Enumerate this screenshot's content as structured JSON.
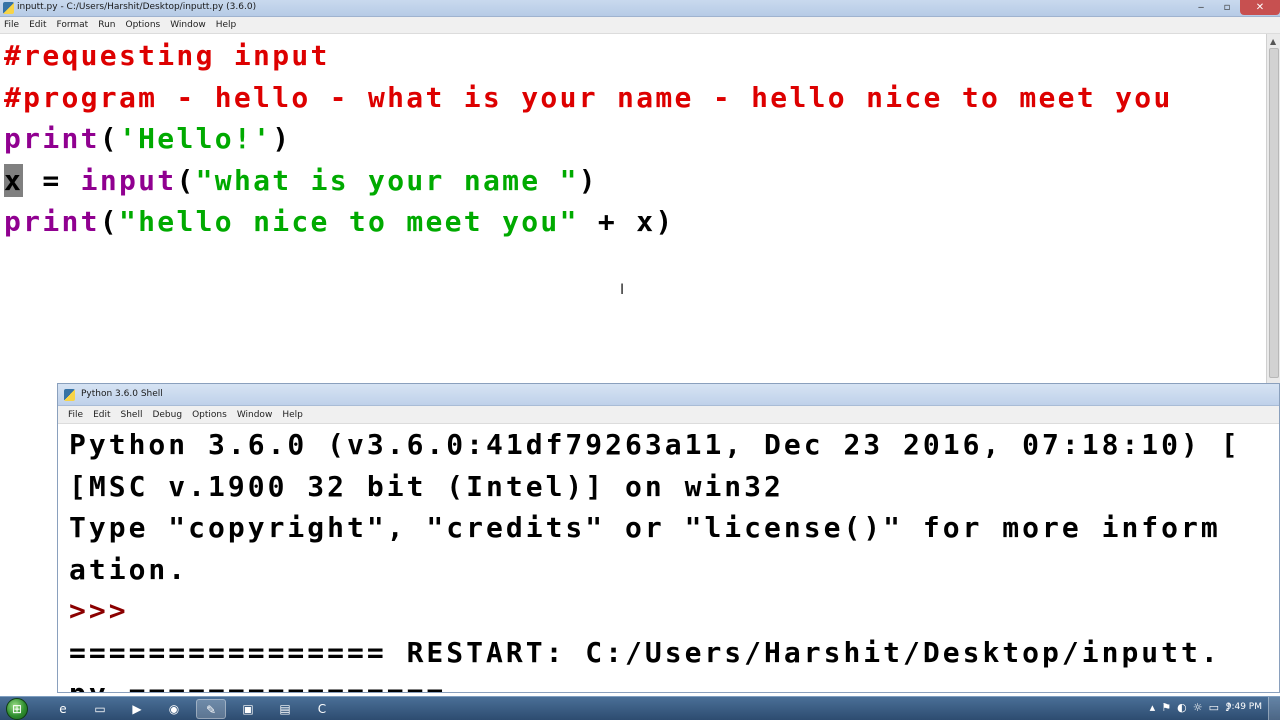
{
  "editor": {
    "title": "inputt.py - C:/Users/Harshit/Desktop/inputt.py (3.6.0)",
    "menu": [
      "File",
      "Edit",
      "Format",
      "Run",
      "Options",
      "Window",
      "Help"
    ],
    "code": [
      [
        {
          "text": "#requesting input",
          "kind": "comment"
        }
      ],
      [
        {
          "text": "#program - hello - what is your name - hello nice to meet you",
          "kind": "comment"
        }
      ],
      [
        {
          "text": "print",
          "kind": "builtin"
        },
        {
          "text": "(",
          "kind": "plain"
        },
        {
          "text": "'Hello!'",
          "kind": "string"
        },
        {
          "text": ")",
          "kind": "plain"
        }
      ],
      [
        {
          "text": "x",
          "kind": "selected"
        },
        {
          "text": " = ",
          "kind": "plain"
        },
        {
          "text": "input",
          "kind": "builtin"
        },
        {
          "text": "(",
          "kind": "plain"
        },
        {
          "text": "\"what is your name \"",
          "kind": "string"
        },
        {
          "text": ")",
          "kind": "plain"
        }
      ],
      [
        {
          "text": "print",
          "kind": "builtin"
        },
        {
          "text": "(",
          "kind": "plain"
        },
        {
          "text": "\"hello nice to meet you\"",
          "kind": "string"
        },
        {
          "text": " + x)",
          "kind": "plain"
        }
      ]
    ]
  },
  "window_controls": {
    "minimize": "‒",
    "maximize": "▫",
    "close": "✕"
  },
  "shell": {
    "title": "Python 3.6.0 Shell",
    "menu": [
      "File",
      "Edit",
      "Shell",
      "Debug",
      "Options",
      "Window",
      "Help"
    ],
    "lines": [
      {
        "text": "Python 3.6.0 (v3.6.0:41df79263a11, Dec 23 2016, 07:18:10) [",
        "kind": "plain"
      },
      {
        "text": "[MSC v.1900 32 bit (Intel)] on win32",
        "kind": "plain"
      },
      {
        "text": "Type \"copyright\", \"credits\" or \"license()\" for more inform",
        "kind": "plain"
      },
      {
        "text": "ation.",
        "kind": "plain"
      },
      {
        "text": ">>> ",
        "kind": "prompt"
      },
      {
        "text": "================ RESTART: C:/Users/Harshit/Desktop/inputt.",
        "kind": "plain"
      },
      {
        "text": "py ================",
        "kind": "plain"
      }
    ]
  },
  "taskbar": {
    "start_glyph": "⊞",
    "pinned": [
      {
        "icon": "internet-explorer-icon",
        "glyph": "e",
        "active": false
      },
      {
        "icon": "folder-icon",
        "glyph": "▭",
        "active": false
      },
      {
        "icon": "media-player-icon",
        "glyph": "▶",
        "active": false
      },
      {
        "icon": "chrome-icon",
        "glyph": "◉",
        "active": false
      },
      {
        "icon": "python-idle-icon",
        "glyph": "✎",
        "active": true
      },
      {
        "icon": "control-panel-icon",
        "glyph": "▣",
        "active": false
      },
      {
        "icon": "notepad-icon",
        "glyph": "▤",
        "active": false
      },
      {
        "icon": "ccleaner-icon",
        "glyph": "C",
        "active": false
      }
    ],
    "tray_glyphs": [
      "▴",
      "⚑",
      "◐",
      "☼",
      "▭",
      "♪"
    ],
    "clock": "9:49 PM"
  }
}
